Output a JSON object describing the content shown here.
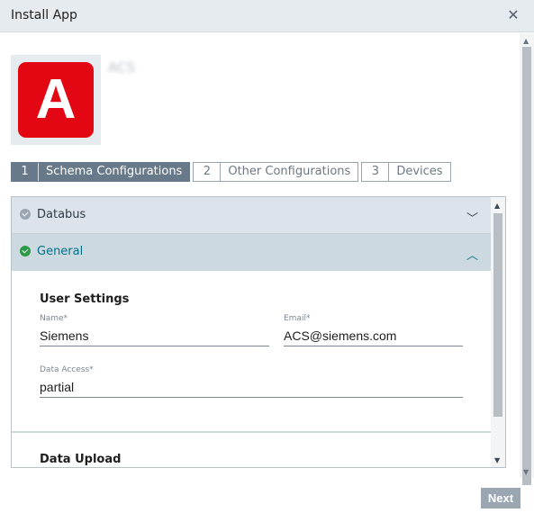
{
  "dialog": {
    "title": "Install App",
    "close_icon": "close-icon"
  },
  "app": {
    "logo_letter": "A",
    "logo_color": "#e30613",
    "name": "ACS"
  },
  "steps": [
    {
      "number": "1",
      "label": "Schema Configurations",
      "active": true
    },
    {
      "number": "2",
      "label": "Other Configurations",
      "active": false
    },
    {
      "number": "3",
      "label": "Devices",
      "active": false
    }
  ],
  "accordion": {
    "databus": {
      "label": "Databus",
      "icon": "check-circle-icon",
      "chevron": "chevron-down-icon",
      "expanded": false
    },
    "general": {
      "label": "General",
      "icon": "check-circle-icon",
      "chevron": "chevron-up-icon",
      "expanded": true
    }
  },
  "user_settings": {
    "title": "User Settings",
    "name": {
      "label": "Name*",
      "value": "Siemens"
    },
    "email": {
      "label": "Email*",
      "value": "ACS@siemens.com"
    },
    "data_access": {
      "label": "Data Access*",
      "value": "partial"
    }
  },
  "data_upload": {
    "title": "Data Upload"
  },
  "footer": {
    "next_label": "Next"
  },
  "colors": {
    "accent": "#00708a",
    "success": "#2b9a46",
    "active_step": "#687989"
  }
}
